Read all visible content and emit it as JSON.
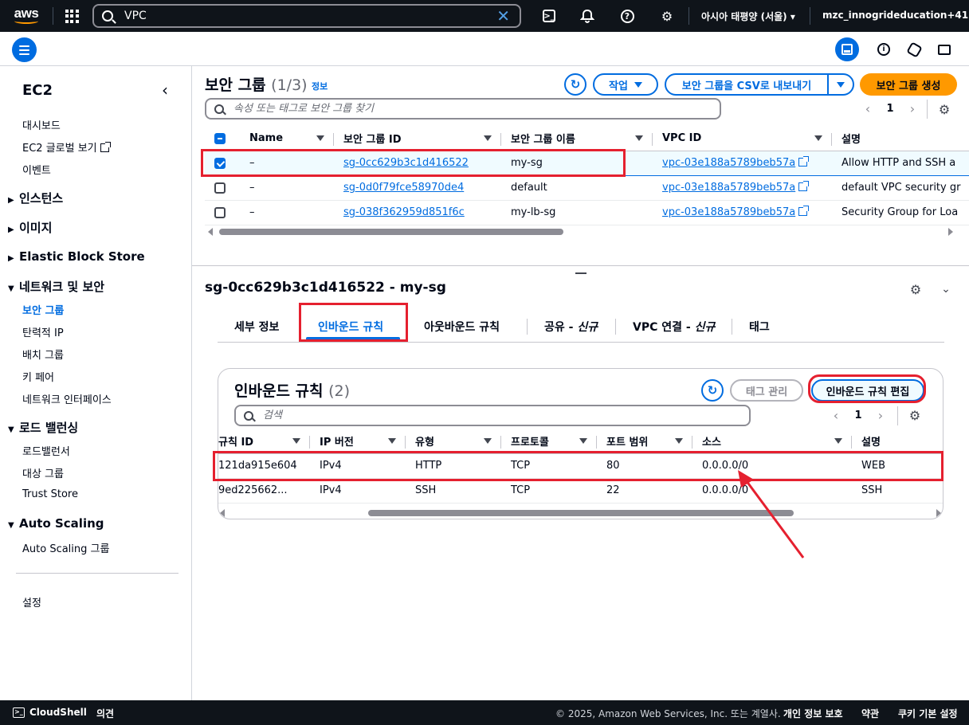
{
  "topnav": {
    "logo": "aws",
    "search_value": "VPC",
    "region": "아시아 태평양 (서울)",
    "account": "mzc_innogrideducation+41"
  },
  "sidebar": {
    "title": "EC2",
    "links_top": [
      "대시보드",
      "EC2 글로벌 보기",
      "이벤트"
    ],
    "sections": [
      {
        "label": "인스턴스",
        "expanded": false
      },
      {
        "label": "이미지",
        "expanded": false
      },
      {
        "label": "Elastic Block Store",
        "expanded": false
      },
      {
        "label": "네트워크 및 보안",
        "expanded": true,
        "items": [
          "보안 그룹",
          "탄력적 IP",
          "배치 그룹",
          "키 페어",
          "네트워크 인터페이스"
        ]
      },
      {
        "label": "로드 밸런싱",
        "expanded": true,
        "items": [
          "로드밸런서",
          "대상 그룹",
          "Trust Store"
        ]
      },
      {
        "label": "Auto Scaling",
        "expanded": true,
        "items": [
          "Auto Scaling 그룹"
        ]
      }
    ],
    "active_item": "보안 그룹",
    "settings": "설정"
  },
  "sg_panel": {
    "title": "보안 그룹",
    "count": "(1/3)",
    "info": "정보",
    "actions_label": "작업",
    "export_label": "보안 그룹을 CSV로 내보내기",
    "create_label": "보안 그룹 생성",
    "filter_placeholder": "속성 또는 태그로 보안 그룹 찾기",
    "page": "1",
    "columns": [
      "Name",
      "보안 그룹 ID",
      "보안 그룹 이름",
      "VPC ID",
      "설명"
    ],
    "rows": [
      {
        "selected": true,
        "name": "–",
        "id": "sg-0cc629b3c1d416522",
        "group_name": "my-sg",
        "vpc": "vpc-03e188a5789beb57a",
        "desc": "Allow HTTP and SSH a"
      },
      {
        "selected": false,
        "name": "–",
        "id": "sg-0d0f79fce58970de4",
        "group_name": "default",
        "vpc": "vpc-03e188a5789beb57a",
        "desc": "default VPC security gr"
      },
      {
        "selected": false,
        "name": "–",
        "id": "sg-038f362959d851f6c",
        "group_name": "my-lb-sg",
        "vpc": "vpc-03e188a5789beb57a",
        "desc": "Security Group for Loa"
      }
    ]
  },
  "detail": {
    "title": "sg-0cc629b3c1d416522 - my-sg",
    "tabs": [
      "세부 정보",
      "인바운드 규칙",
      "아웃바운드 규칙",
      "공유 - ",
      "VPC 연결 - ",
      "태그"
    ],
    "tab_new_suffix": "신규",
    "active_tab": "인바운드 규칙"
  },
  "inbound": {
    "title": "인바운드 규칙",
    "count": "(2)",
    "manage_tags_label": "태그 관리",
    "edit_label": "인바운드 규칙 편집",
    "search_placeholder": "검색",
    "page": "1",
    "columns": [
      "규칙 ID",
      "IP 버전",
      "유형",
      "프로토콜",
      "포트 범위",
      "소스",
      "설명"
    ],
    "rows": [
      {
        "rule_id": "121da915e604",
        "ip": "IPv4",
        "type": "HTTP",
        "protocol": "TCP",
        "port": "80",
        "source": "0.0.0.0/0",
        "desc": "WEB"
      },
      {
        "rule_id": "9ed225662...",
        "ip": "IPv4",
        "type": "SSH",
        "protocol": "TCP",
        "port": "22",
        "source": "0.0.0.0/0",
        "desc": "SSH"
      }
    ]
  },
  "footer": {
    "cloudshell": "CloudShell",
    "feedback": "의견",
    "copyright": "© 2025, Amazon Web Services, Inc. 또는 계열사.",
    "privacy": "개인 정보 보호",
    "terms": "약관",
    "cookies": "쿠키 기본 설정"
  },
  "colors": {
    "accent": "#006ce0",
    "primary_button": "#ff9900",
    "nav_bg": "#0f141a",
    "annotation": "#e5202f"
  }
}
